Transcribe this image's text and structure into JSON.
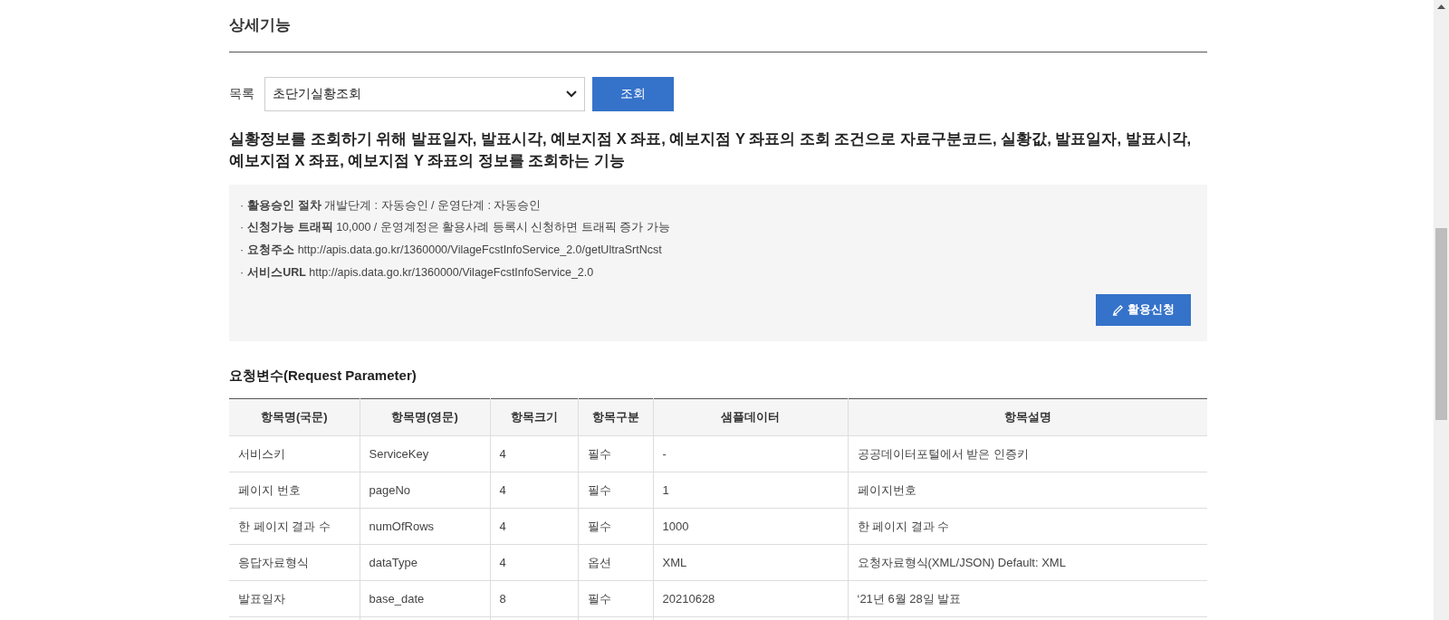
{
  "section_title": "상세기능",
  "list_filter": {
    "label": "목록",
    "value": "초단기실황조회",
    "button": "조회"
  },
  "description": "실황정보를 조회하기 위해 발표일자, 발표시각, 예보지점 X 좌표, 예보지점 Y 좌표의 조회 조건으로 자료구분코드, 실황값, 발표일자, 발표시각, 예보지점 X 좌표, 예보지점 Y 좌표의 정보를 조회하는 기능",
  "info_items": [
    {
      "bullet": "·",
      "text": "**활용승인 절차** 개발단계 : 자동승인 / 운영단계 : 자동승인"
    },
    {
      "bullet": "·",
      "text": "**신청가능 트래픽** 10,000 / 운영계정은 활용사례 등록시 신청하면 트래픽 증가 가능"
    },
    {
      "bullet": "·",
      "text": "**요청주소** http://apis.data.go.kr/1360000/VilageFcstInfoService_2.0/getUltraSrtNcst"
    },
    {
      "bullet": "·",
      "text": "**서비스URL** http://apis.data.go.kr/1360000/VilageFcstInfoService_2.0"
    }
  ],
  "apply_button": "활용신청",
  "request_parameter": {
    "title": "요청변수(Request Parameter)",
    "columns": [
      "항목명(국문)",
      "항목명(영문)",
      "항목크기",
      "항목구분",
      "샘플데이터",
      "항목설명"
    ],
    "rows": [
      [
        "서비스키",
        "ServiceKey",
        "4",
        "필수",
        "-",
        "공공데이터포털에서 받은 인증키"
      ],
      [
        "페이지 번호",
        "pageNo",
        "4",
        "필수",
        "1",
        "페이지번호"
      ],
      [
        "한 페이지 결과 수",
        "numOfRows",
        "4",
        "필수",
        "1000",
        "한 페이지 결과 수"
      ],
      [
        "응답자료형식",
        "dataType",
        "4",
        "옵션",
        "XML",
        "요청자료형식(XML/JSON) Default: XML"
      ],
      [
        "발표일자",
        "base_date",
        "8",
        "필수",
        "20210628",
        "‘21년 6월 28일 발표"
      ]
    ]
  }
}
